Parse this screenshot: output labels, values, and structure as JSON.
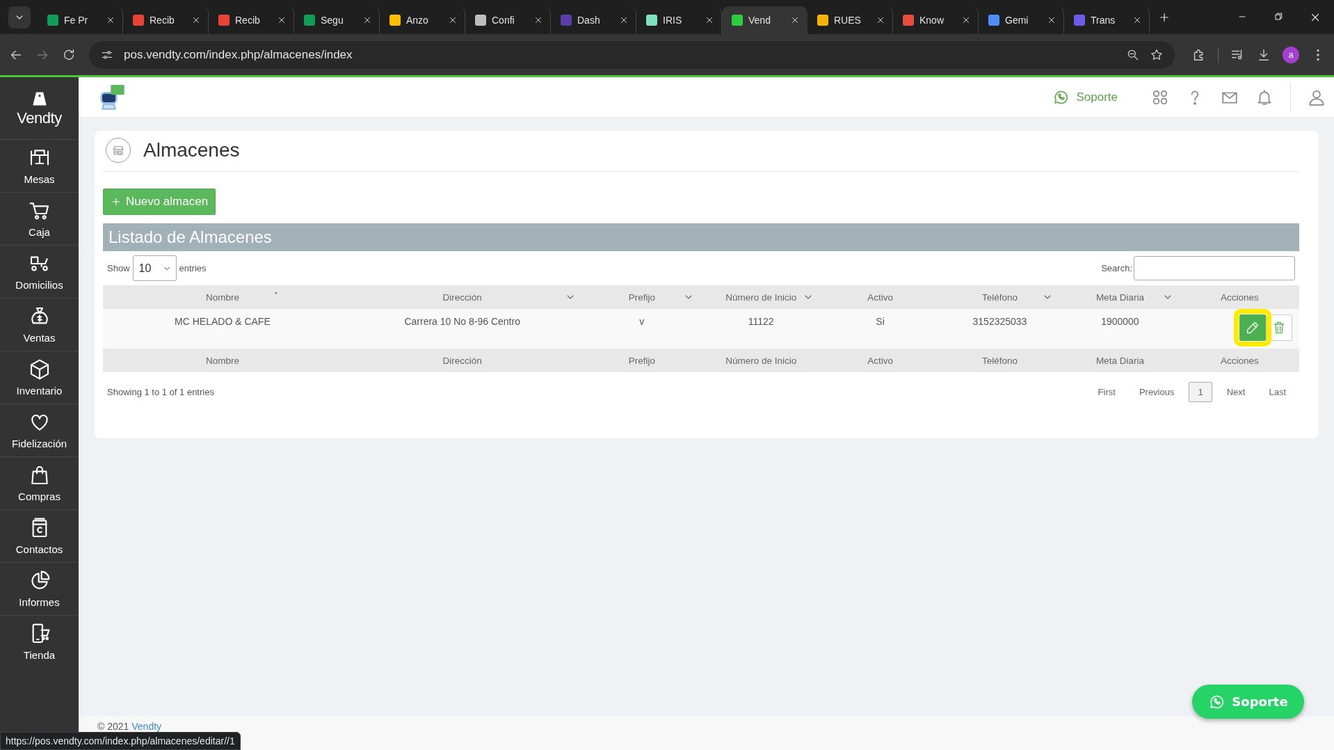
{
  "browser": {
    "tabs": [
      {
        "label": "Fe Pr",
        "color": "#0f9d58",
        "selected": false
      },
      {
        "label": "Recib",
        "color": "#ea4335",
        "selected": false
      },
      {
        "label": "Recib",
        "color": "#ea4335",
        "selected": false
      },
      {
        "label": "Segu",
        "color": "#0f9d58",
        "selected": false
      },
      {
        "label": "Anzo",
        "color": "#fbbc04",
        "selected": false
      },
      {
        "label": "Confi",
        "color": "#bdbdbd",
        "selected": false
      },
      {
        "label": "Dash",
        "color": "#5b3fa8",
        "selected": false
      },
      {
        "label": "IRIS",
        "color": "#7fe0c0",
        "selected": false
      },
      {
        "label": "Vend",
        "color": "#2ecc40",
        "selected": true
      },
      {
        "label": "RUES",
        "color": "#f4b400",
        "selected": false
      },
      {
        "label": "Know",
        "color": "#e74c3c",
        "selected": false
      },
      {
        "label": "Gemi",
        "color": "#4f8df5",
        "selected": false
      },
      {
        "label": "Trans",
        "color": "#6c5ce7",
        "selected": false
      }
    ],
    "url": "pos.vendty.com/index.php/almacenes/index",
    "profile_initial": "a"
  },
  "sidebar": {
    "brand": "Vendty",
    "items": [
      {
        "label": "Mesas"
      },
      {
        "label": "Caja"
      },
      {
        "label": "Domicilios"
      },
      {
        "label": "Ventas"
      },
      {
        "label": "Inventario"
      },
      {
        "label": "Fidelización"
      },
      {
        "label": "Compras"
      },
      {
        "label": "Contactos"
      },
      {
        "label": "Informes"
      },
      {
        "label": "Tienda"
      }
    ]
  },
  "header": {
    "support_label": "Soporte"
  },
  "page": {
    "title": "Almacenes",
    "new_button": "Nuevo almacen",
    "list_title": "Listado de Almacenes",
    "length": {
      "before": "Show",
      "value": "10",
      "after": "entries"
    },
    "search_label": "Search:",
    "columns": [
      {
        "label": "Nombre",
        "sortable": true,
        "sorted": true
      },
      {
        "label": "Dirección",
        "sortable": true,
        "sorted": false
      },
      {
        "label": "Prefijo",
        "sortable": true,
        "sorted": false
      },
      {
        "label": "Número de Inicio",
        "sortable": true,
        "sorted": false
      },
      {
        "label": "Activo",
        "sortable": false,
        "sorted": false
      },
      {
        "label": "Teléfono",
        "sortable": true,
        "sorted": false
      },
      {
        "label": "Meta Diaria",
        "sortable": true,
        "sorted": false
      },
      {
        "label": "Acciones",
        "sortable": false,
        "sorted": false
      }
    ],
    "rows": [
      {
        "cells": [
          "MC HELADO & CAFE",
          "Carrera 10 No 8-96 Centro",
          "v",
          "11122",
          "Si",
          "3152325033",
          "1900000"
        ],
        "actions": [
          {
            "kind": "edit",
            "highlighted": true
          },
          {
            "kind": "delete",
            "highlighted": false
          }
        ]
      }
    ],
    "footer_columns": [
      "Nombre",
      "Dirección",
      "Prefijo",
      "Número de Inicio",
      "Activo",
      "Teléfono",
      "Meta Diaria",
      "Acciones"
    ],
    "info": "Showing 1 to 1 of 1 entries",
    "pagination": [
      {
        "label": "First",
        "selected": false
      },
      {
        "label": "Previous",
        "selected": false
      },
      {
        "label": "1",
        "selected": true
      },
      {
        "label": "Next",
        "selected": false
      },
      {
        "label": "Last",
        "selected": false
      }
    ]
  },
  "footer": {
    "copyright": "© 2021",
    "link": "Vendty"
  },
  "support_button": "Soporte",
  "status_url": "https://pos.vendty.com/index.php/almacenes/editar//1"
}
